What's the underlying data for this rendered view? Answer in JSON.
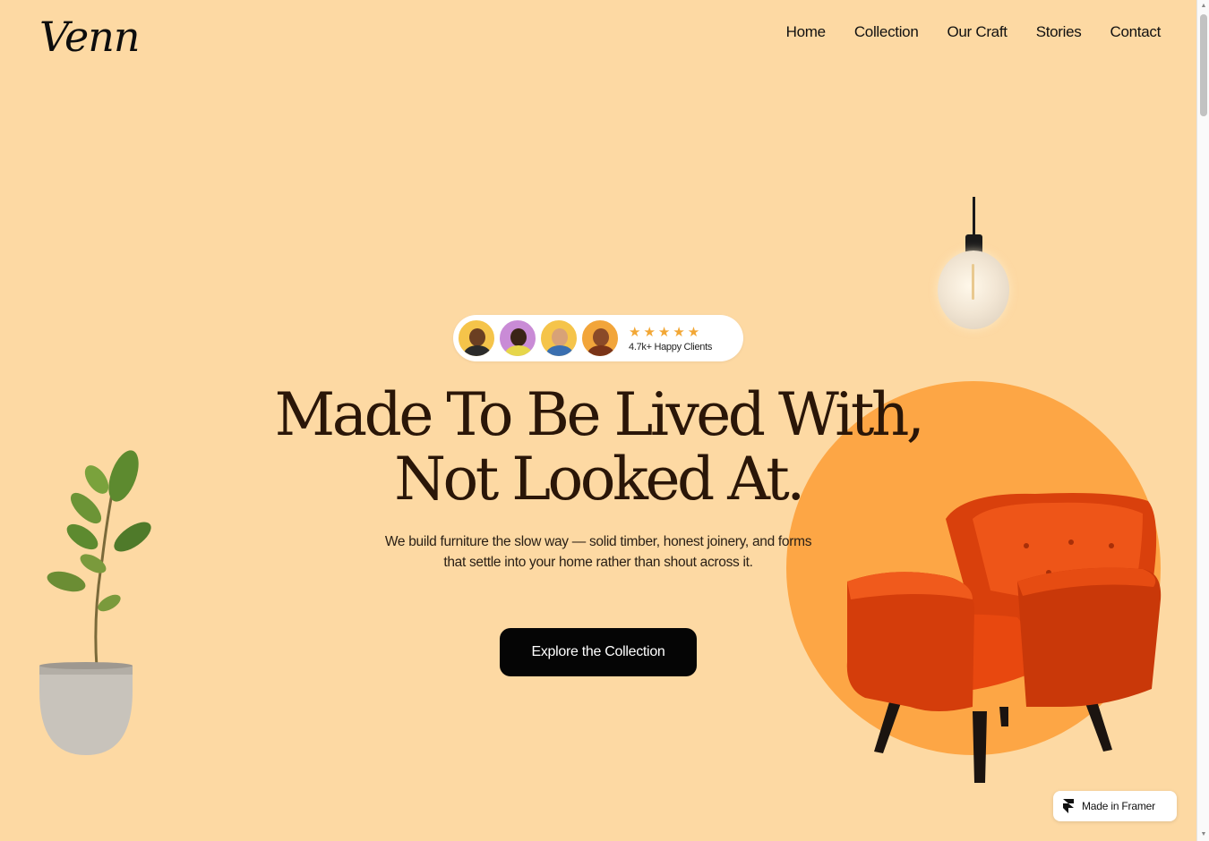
{
  "brand": {
    "logo": "Venn"
  },
  "nav": {
    "items": [
      {
        "label": "Home"
      },
      {
        "label": "Collection"
      },
      {
        "label": "Our Craft"
      },
      {
        "label": "Stories"
      },
      {
        "label": "Contact"
      }
    ]
  },
  "hero": {
    "social_proof": {
      "stars": "★★★★★",
      "text": "4.7k+ Happy Clients",
      "avatar_colors": [
        "#f5c44a",
        "#c98bd6",
        "#f5c44a",
        "#f2a53a"
      ]
    },
    "headline_line1": "Made To Be Lived With,",
    "headline_line2": "Not Looked At.",
    "subtext_line1": "We build furniture the slow way — solid timber, honest joinery, and forms",
    "subtext_line2": "that settle into your home rather than shout across it.",
    "cta_label": "Explore the Collection"
  },
  "badge": {
    "label": "Made in Framer"
  },
  "colors": {
    "background": "#fdd9a3",
    "accent_circle": "#fda645",
    "armchair": "#e8480f",
    "headline": "#2a1608",
    "cta": "#050505"
  },
  "icons": [
    "pendant-lamp",
    "armchair",
    "potted-plant",
    "framer-logo-icon",
    "star-icon"
  ]
}
